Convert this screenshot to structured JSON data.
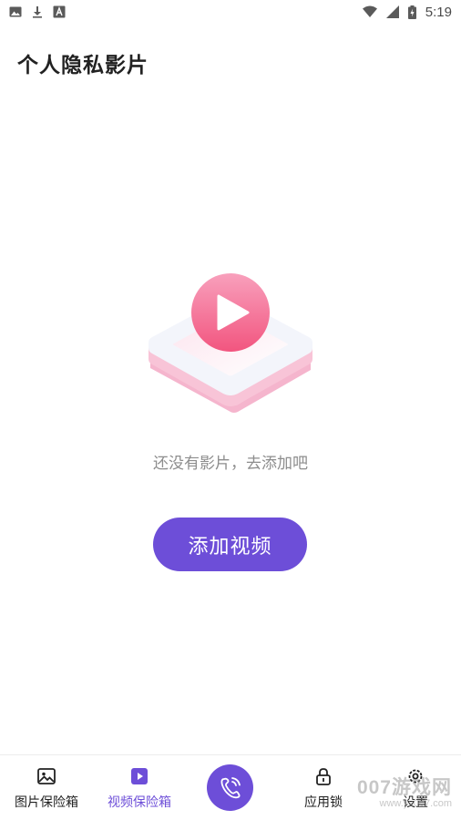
{
  "status_bar": {
    "time": "5:19",
    "left_icons": [
      "image-icon",
      "download-icon",
      "font-icon"
    ],
    "right_icons": [
      "wifi-icon",
      "signal-icon",
      "battery-icon"
    ]
  },
  "page": {
    "title": "个人隐私影片"
  },
  "empty_state": {
    "message": "还没有影片，去添加吧",
    "illustration": "video-play-icon"
  },
  "primary_action": {
    "label": "添加视频"
  },
  "bottom_nav": {
    "items": [
      {
        "label": "图片保险箱",
        "icon": "image-icon",
        "active": false
      },
      {
        "label": "视频保险箱",
        "icon": "video-icon",
        "active": true
      },
      {
        "label": "",
        "icon": "phone-icon",
        "active": false
      },
      {
        "label": "应用锁",
        "icon": "lock-icon",
        "active": false
      },
      {
        "label": "设置",
        "icon": "gear-icon",
        "active": false
      }
    ]
  },
  "watermark": {
    "title": "007游戏网",
    "url": "www.yx007.com"
  },
  "colors": {
    "accent": "#6d4ed8",
    "play_pink": "#f4618e",
    "text_muted": "#8d8d8d"
  }
}
